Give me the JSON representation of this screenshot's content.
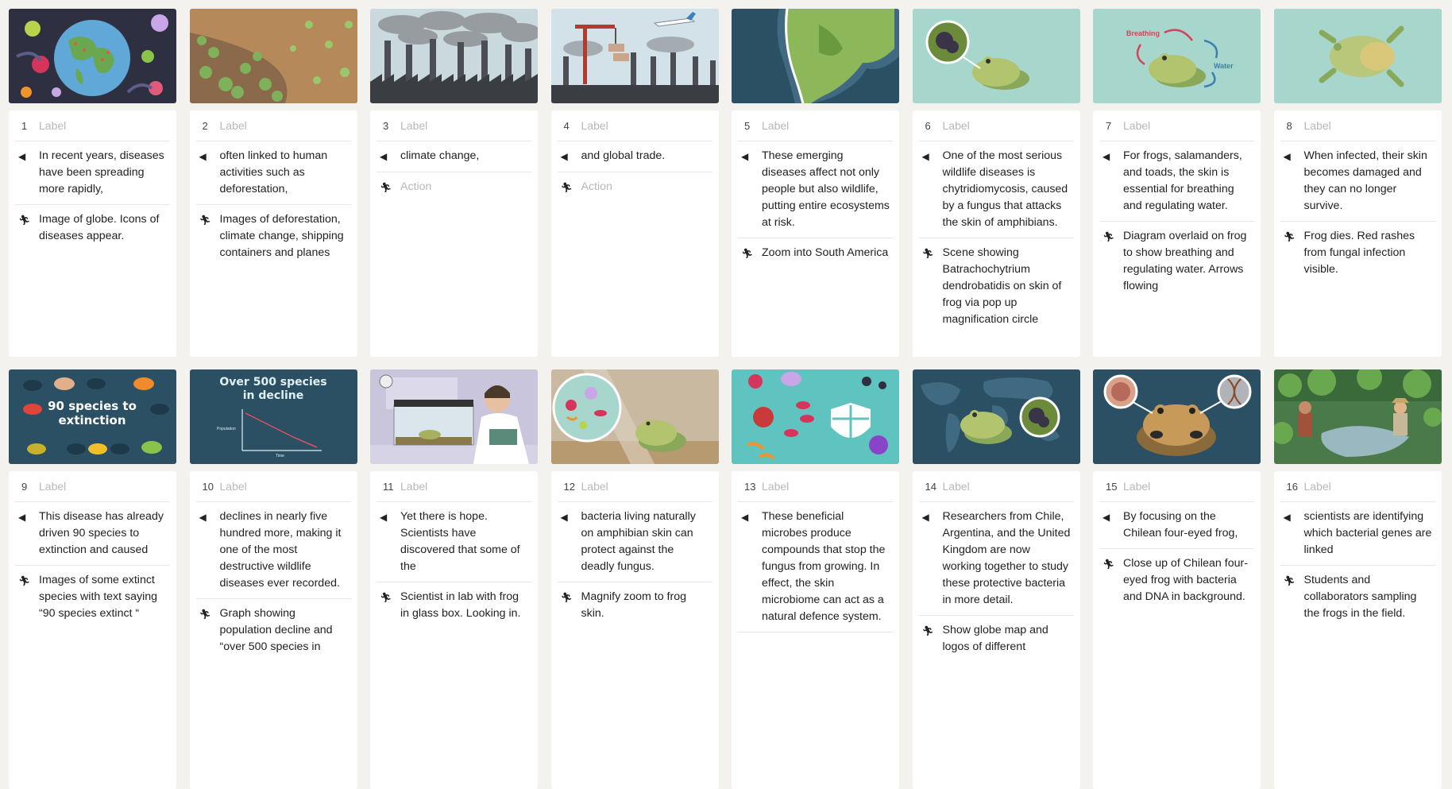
{
  "label_placeholder": "Label",
  "action_placeholder": "Action",
  "icons": {
    "narration": "speaker-icon",
    "action": "running-person-icon"
  },
  "colors": {
    "background": "#f3f2ee",
    "card": "#ffffff",
    "teal": "#a6d6cc",
    "navy": "#244858"
  },
  "frames": [
    {
      "number": "1",
      "narration": "In recent years, diseases have been spreading more rapidly,",
      "action": "Image of globe. Icons of diseases appear."
    },
    {
      "number": "2",
      "narration": "often linked to human activities such as deforestation,",
      "action": "Images of deforestation, climate change, shipping containers and planes"
    },
    {
      "number": "3",
      "narration": "climate change,",
      "action": ""
    },
    {
      "number": "4",
      "narration": "and global trade.",
      "action": ""
    },
    {
      "number": "5",
      "narration": "These emerging diseases affect not only people but also wildlife, putting entire ecosystems at risk.",
      "action": "Zoom into South America"
    },
    {
      "number": "6",
      "narration": "One of the most serious wildlife diseases is chytridiomycosis, caused by a fungus that attacks the skin of amphibians.",
      "action": "Scene showing Batrachochytrium dendrobatidis on skin of frog via pop up magnification circle"
    },
    {
      "number": "7",
      "narration": "For frogs, salamanders, and toads, the skin is essential for breathing and regulating water.",
      "action": "Diagram overlaid on frog to show breathing and regulating water. Arrows flowing"
    },
    {
      "number": "8",
      "narration": "When infected, their skin becomes damaged and they can no longer survive.",
      "action": "Frog dies. Red rashes from fungal infection visible."
    },
    {
      "number": "9",
      "narration": "This disease has already driven 90 species to extinction and caused",
      "action": "Images of some extinct species with text saying “90 species extinct “"
    },
    {
      "number": "10",
      "narration": "declines in nearly five hundred more, making it one of the most destructive wildlife diseases ever recorded.",
      "action": "Graph showing population decline and “over 500 species in"
    },
    {
      "number": "11",
      "narration": "Yet there is hope. Scientists have discovered that some of the",
      "action": "Scientist in lab with frog in glass box. Looking in."
    },
    {
      "number": "12",
      "narration": "bacteria living naturally on amphibian skin can protect against the deadly fungus.",
      "action": "Magnify zoom to frog skin."
    },
    {
      "number": "13",
      "narration": "These beneficial microbes produce compounds that stop the fungus from growing. In effect, the skin microbiome can act as a natural defence system.",
      "action": ""
    },
    {
      "number": "14",
      "narration": "Researchers from Chile, Argentina, and the United Kingdom are now working together to study these protective bacteria in more detail.",
      "action": "Show globe map and logos of different"
    },
    {
      "number": "15",
      "narration": "By focusing on the Chilean four-eyed frog,",
      "action": "Close up of Chilean four-eyed frog with bacteria and DNA in background."
    },
    {
      "number": "16",
      "narration": "scientists are identifying which bacterial genes are linked",
      "action": "Students and collaborators sampling the frogs in the field."
    }
  ],
  "thumb_text": {
    "t7_breathing": "Breathing",
    "t7_water": "Water",
    "t9_title": "90 species to extinction",
    "t10_title": "Over 500 species in decline",
    "t10_ylabel": "Population",
    "t10_xlabel": "Time"
  }
}
